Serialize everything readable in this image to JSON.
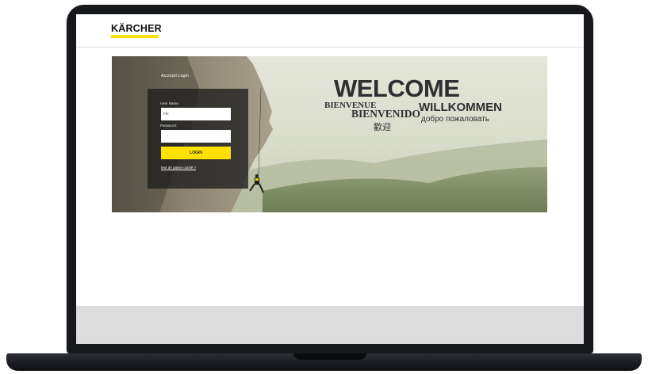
{
  "brand": {
    "logo_text": "KÄRCHER",
    "accent_color": "#ffe000"
  },
  "login": {
    "panel_title": "Account Login",
    "username_label": "User Name:",
    "username_prefix": "FR-",
    "password_label": "Password:",
    "login_button": "LOGIN",
    "forgot_link": "Mot de passe oublié ?"
  },
  "welcome": {
    "welcome": "WELCOME",
    "bienvenue": "BIENVENUE",
    "bienvenido": "BIENVENIDO",
    "willkommen": "WILLKOMMEN",
    "russian": "добро пожаловать",
    "chinese": "歡迎"
  }
}
